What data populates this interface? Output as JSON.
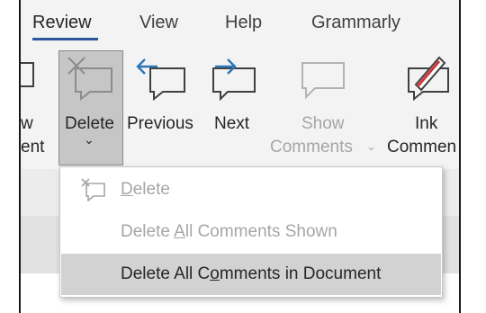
{
  "tabs": [
    {
      "label": "Review",
      "active": true
    },
    {
      "label": "View",
      "active": false
    },
    {
      "label": "Help",
      "active": false
    },
    {
      "label": "Grammarly",
      "active": false
    }
  ],
  "ribbon": {
    "left_partial": {
      "line1": "w",
      "line2": "ent"
    },
    "delete": {
      "label": "Delete",
      "icon": "delete-comment-icon",
      "chevron": "⌄"
    },
    "previous": {
      "label": "Previous",
      "icon": "previous-comment-icon"
    },
    "next": {
      "label": "Next",
      "icon": "next-comment-icon"
    },
    "show_comments": {
      "line1": "Show",
      "line2": "Comments",
      "chevron": "⌄",
      "icon": "show-comments-icon",
      "disabled": true
    },
    "ink": {
      "line1": "Ink",
      "line2": "Commen",
      "icon": "ink-comment-icon"
    }
  },
  "menu": {
    "items": [
      {
        "before": "",
        "underline": "D",
        "after": "elete",
        "disabled": true,
        "icon": "delete-comment-icon"
      },
      {
        "before": "Delete ",
        "underline": "A",
        "after": "ll Comments Shown",
        "disabled": true
      },
      {
        "before": "Delete All C",
        "underline": "o",
        "after": "mments in Document",
        "disabled": false,
        "selected": true
      }
    ]
  },
  "colors": {
    "accent_underline": "#2b579a",
    "arrow_blue": "#2e75b6",
    "ink_red": "#d13438",
    "disabled_text": "#a6a6a6"
  }
}
